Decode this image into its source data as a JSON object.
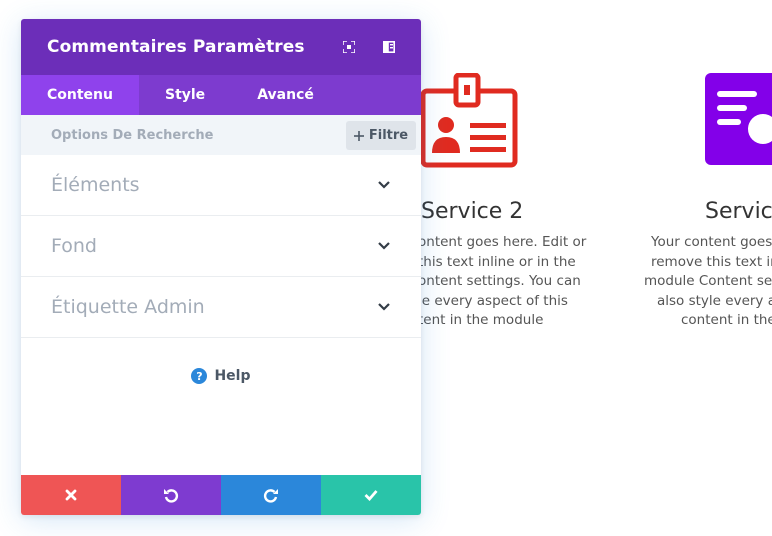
{
  "background": {
    "service2": {
      "title": "Service 2",
      "lines": [
        "ontent goes here. Edit or",
        "this text inline or in the",
        "ontent settings. You can",
        "le every aspect of this",
        "tent in the module"
      ],
      "icon": "id-badge-icon",
      "icon_color": "#e02b20"
    },
    "service3": {
      "title": "Service",
      "lines": [
        "Your content goes",
        "remove this text in",
        "module Content set",
        "also style every as",
        "content in the"
      ],
      "icon": "document-search-icon",
      "icon_color": "#8300e9"
    }
  },
  "panel": {
    "title": "Commentaires Paramètres",
    "expand_icon": "expand-icon",
    "split_icon": "split-view-icon",
    "tabs": [
      {
        "label": "Contenu",
        "active": true
      },
      {
        "label": "Style",
        "active": false
      },
      {
        "label": "Avancé",
        "active": false
      }
    ],
    "search": {
      "label": "Options De Recherche",
      "filter_label": "Filtre"
    },
    "sections": [
      {
        "label": "Éléments"
      },
      {
        "label": "Fond"
      },
      {
        "label": "Étiquette Admin"
      }
    ],
    "help_label": "Help",
    "footer": {
      "discard_icon": "close-icon",
      "undo_icon": "undo-icon",
      "redo_icon": "redo-icon",
      "save_icon": "check-icon"
    },
    "colors": {
      "header": "#6c2eb9",
      "tabs": "#7d3bcf",
      "tab_active": "#8f42ec",
      "discard": "#ef5555",
      "undo": "#7e3bd0",
      "redo": "#2b87da",
      "save": "#29c4a9"
    }
  }
}
